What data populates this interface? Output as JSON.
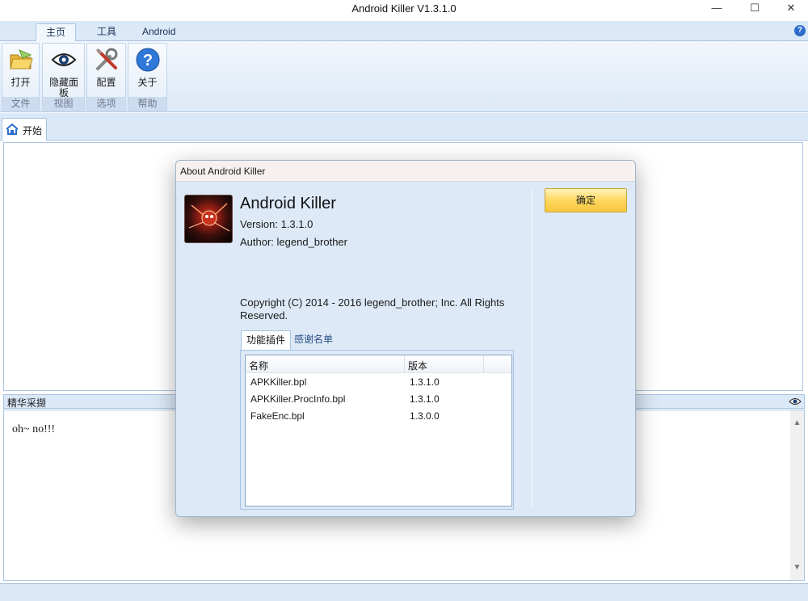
{
  "window": {
    "title": "Android Killer V1.3.1.0",
    "controls": {
      "minimize": "—",
      "maximize": "☐",
      "close": "✕"
    }
  },
  "ribbon": {
    "tabs": [
      "主页",
      "工具",
      "Android"
    ],
    "active_tab": "主页",
    "groups": [
      {
        "button": "打开",
        "group": "文件",
        "icon": "open-folder-icon"
      },
      {
        "button": "隐藏面板",
        "group": "视图",
        "icon": "eye-icon"
      },
      {
        "button": "配置",
        "group": "选项",
        "icon": "settings-tools-icon"
      },
      {
        "button": "关于",
        "group": "帮助",
        "icon": "help-icon"
      }
    ],
    "help_glyph": "?"
  },
  "doc_tabs": [
    {
      "label": "开始",
      "icon": "home-icon"
    }
  ],
  "bottom_panel": {
    "title": "精华采撷",
    "content": "oh~ no!!!"
  },
  "about_dialog": {
    "title": "About Android Killer",
    "app_name": "Android Killer",
    "version": "Version: 1.3.1.0",
    "author": "Author: legend_brother",
    "copyright": "Copyright (C) 2014 - 2016 legend_brother; Inc. All Rights Reserved.",
    "ok_button": "确定",
    "tabs": [
      "功能插件",
      "感谢名单"
    ],
    "active_tab": "功能插件",
    "plugins_table": {
      "columns": [
        "名称",
        "版本"
      ],
      "rows": [
        {
          "name": "APKKiller.bpl",
          "version": "1.3.1.0"
        },
        {
          "name": "APKKiller.ProcInfo.bpl",
          "version": "1.3.1.0"
        },
        {
          "name": "FakeEnc.bpl",
          "version": "1.3.0.0"
        }
      ]
    }
  },
  "colors": {
    "ribbon_bg": "#dbe8f7",
    "dialog_bg": "#dde9f7",
    "ok_button": "#ffd75e",
    "accent_blue": "#2c6cc8"
  }
}
